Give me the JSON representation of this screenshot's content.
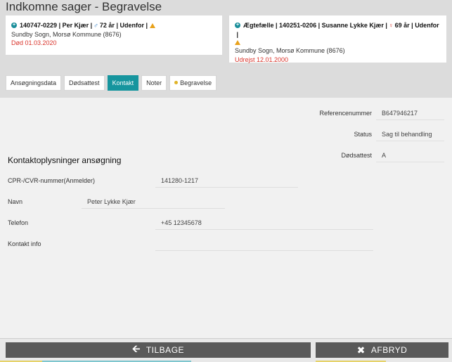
{
  "page": {
    "title": "Indkomne sager - Begravelse"
  },
  "cards": [
    {
      "cpr": "140747-0229",
      "name": "Per Kjær",
      "age": "72 år",
      "location_status": "Udenfor",
      "parish": "Sundby Sogn, Morsø Kommune (8676)",
      "status_line": "Død 01.03.2020",
      "gender_icon": "male-icon"
    },
    {
      "relation": "Ægtefælle",
      "cpr": "140251-0206",
      "name": "Susanne Lykke Kjær",
      "age": "69 år",
      "location_status": "Udenfor",
      "parish": "Sundby Sogn, Morsø Kommune (8676)",
      "status_line": "Udrejst 12.01.2000",
      "gender_icon": "female-icon"
    }
  ],
  "tabs": [
    {
      "label": "Ansøgningsdata",
      "active": false
    },
    {
      "label": "Dødsattest",
      "active": false
    },
    {
      "label": "Kontakt",
      "active": true
    },
    {
      "label": "Noter",
      "active": false
    },
    {
      "label": "Begravelse",
      "active": false
    }
  ],
  "case_info": {
    "reference_label": "Referencenummer",
    "reference_value": "B647946217",
    "status_label": "Status",
    "status_value": "Sag til behandling",
    "death_cert_label": "Dødsattest",
    "death_cert_value": "A"
  },
  "contact": {
    "section_title": "Kontaktoplysninger ansøgning",
    "cpr_label": "CPR-/CVR-nummer(Anmelder)",
    "cpr_value": "141280-1217",
    "name_label": "Navn",
    "name_value": "Peter Lykke Kjær",
    "phone_label": "Telefon",
    "phone_value": "+45 12345678",
    "contact_info_label": "Kontakt info",
    "contact_info_value": ""
  },
  "footer": {
    "back_label": "TILBAGE",
    "cancel_label": "AFBRYD"
  },
  "colors": {
    "accent": "#16959e",
    "warning": "#e8a11a",
    "danger": "#d9342b",
    "button": "#595959"
  }
}
